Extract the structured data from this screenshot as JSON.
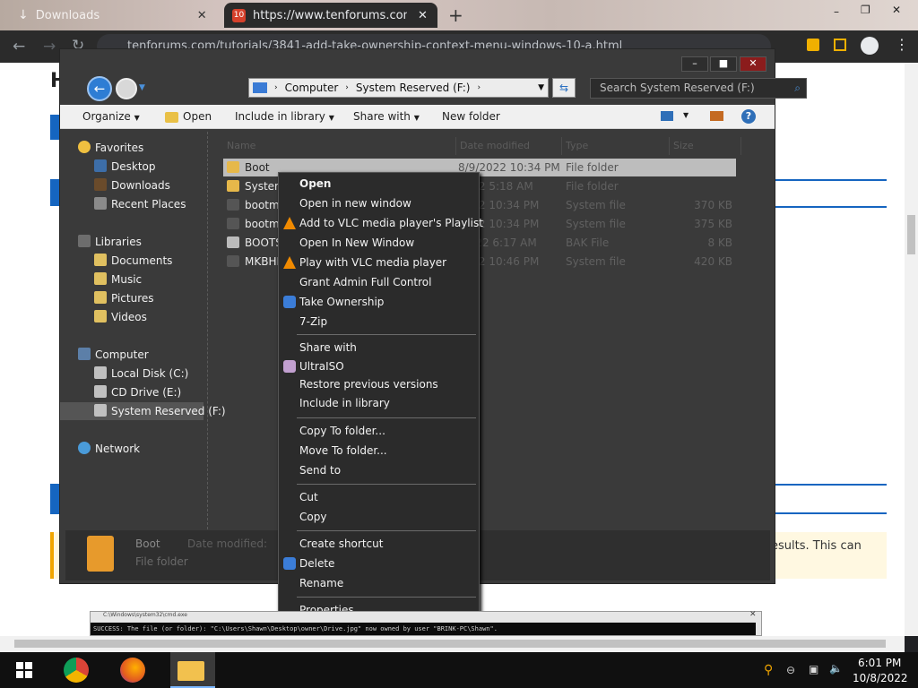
{
  "browser": {
    "tabs": [
      {
        "label": "Downloads"
      },
      {
        "label": "https://www.tenforums.com/tuto"
      }
    ],
    "url": "tenforums.com/tutorials/3841-add-take-ownership-context-menu-windows-10-a.html"
  },
  "page": {
    "heading_letter": "H",
    "warning_text": "esults. This can"
  },
  "explorer": {
    "breadcrumb": [
      "Computer",
      "System Reserved (F:)"
    ],
    "search_placeholder": "Search System Reserved (F:)",
    "commands": {
      "organize": "Organize",
      "open": "Open",
      "include_in_library": "Include in library",
      "share_with": "Share with",
      "new_folder": "New folder"
    },
    "columns": [
      "Name",
      "Date modified",
      "Type",
      "Size"
    ],
    "nav": {
      "favorites": {
        "label": "Favorites",
        "items": [
          "Desktop",
          "Downloads",
          "Recent Places"
        ]
      },
      "libraries": {
        "label": "Libraries",
        "items": [
          "Documents",
          "Music",
          "Pictures",
          "Videos"
        ]
      },
      "computer": {
        "label": "Computer",
        "items": [
          "Local Disk (C:)",
          "CD Drive (E:)",
          "System Reserved (F:)"
        ]
      },
      "network": {
        "label": "Network"
      }
    },
    "files": [
      {
        "name": "Boot",
        "date": "8/9/2022 10:34 PM",
        "type": "File folder",
        "size": ""
      },
      {
        "name": "System",
        "date": "2022 5:18 AM",
        "type": "File folder",
        "size": ""
      },
      {
        "name": "bootmg",
        "date": "2022 10:34 PM",
        "type": "System file",
        "size": "370 KB"
      },
      {
        "name": "bootmg",
        "date": "2022 10:34 PM",
        "type": "System file",
        "size": "375 KB"
      },
      {
        "name": "BOOTS",
        "date": "/2022 6:17 AM",
        "type": "BAK File",
        "size": "8 KB"
      },
      {
        "name": "MKBHL",
        "date": "2022 10:46 PM",
        "type": "System file",
        "size": "420 KB"
      }
    ],
    "details": {
      "name": "Boot",
      "modified_label": "Date modified:",
      "type": "File folder"
    }
  },
  "context_menu": {
    "group1": [
      "Open",
      "Open in new window",
      "Add to VLC media player's Playlist",
      "Open In New Window",
      "Play with VLC media player",
      "Grant Admin Full Control",
      "Take Ownership",
      "7-Zip"
    ],
    "group2": [
      "Share with",
      "UltraISO",
      "Restore previous versions",
      "Include in library"
    ],
    "group3": [
      "Copy To folder...",
      "Move To folder...",
      "Send to"
    ],
    "group4": [
      "Cut",
      "Copy"
    ],
    "group5": [
      "Create shortcut",
      "Delete",
      "Rename"
    ],
    "group6": [
      "Properties"
    ]
  },
  "cmd": {
    "title": "C:\\Windows\\system32\\cmd.exe",
    "text": "SUCCESS: The file (or folder): \"C:\\Users\\Shawn\\Desktop\\owner\\Drive.jpg\" now owned by user \"BRINK-PC\\Shawn\"."
  },
  "taskbar": {
    "time": "6:01 PM",
    "date": "10/8/2022"
  },
  "colors": {
    "accent": "#1a73e8",
    "explorer_bg": "#3a3a3a",
    "menu_bg": "#2b2b2b",
    "page_blue": "#1565c0"
  }
}
